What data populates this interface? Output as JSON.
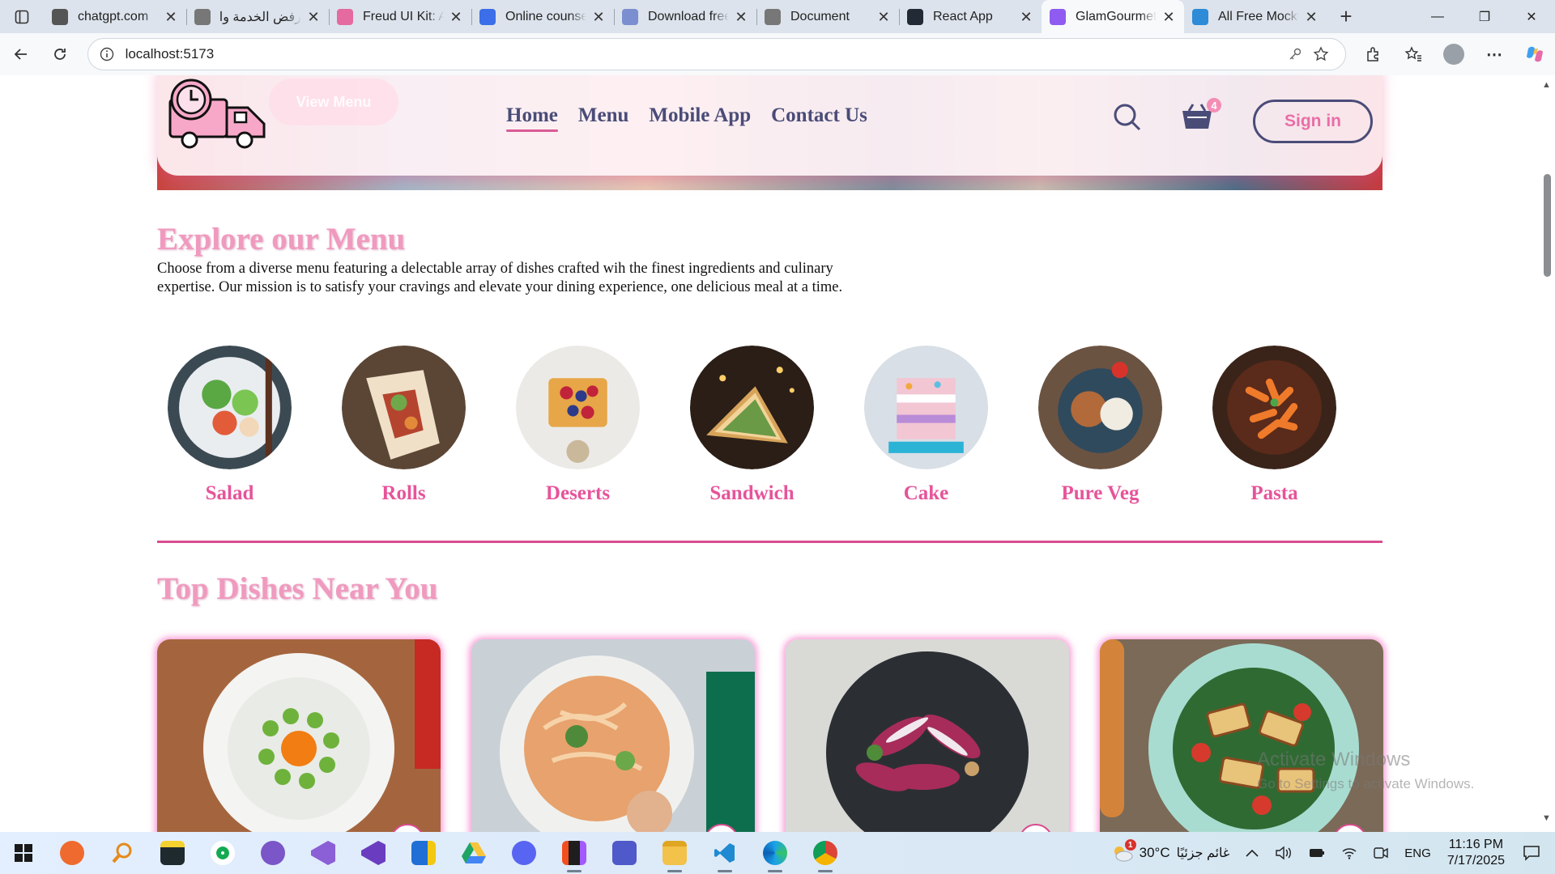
{
  "browser": {
    "tabs": [
      {
        "title": "chatgpt.com",
        "favicon": "chatgpt-icon",
        "color": "#555555"
      },
      {
        "title": "رفض الخدمة وال",
        "favicon": "globe-icon",
        "color": "#777777"
      },
      {
        "title": "Freud UI Kit: AI",
        "favicon": "figma-like-icon",
        "color": "#e46aa0"
      },
      {
        "title": "Online counsell",
        "favicon": "behance-icon",
        "color": "#3b6ee8"
      },
      {
        "title": "Download free",
        "favicon": "s-icon",
        "color": "#7b8fd0"
      },
      {
        "title": "Document",
        "favicon": "globe-icon",
        "color": "#777777"
      },
      {
        "title": "React App",
        "favicon": "react-icon",
        "color": "#222a36"
      },
      {
        "title": "GlamGourmet",
        "favicon": "vite-icon",
        "color": "#8f5bf0",
        "active": true
      },
      {
        "title": "All Free Mocku",
        "favicon": "mockup-icon",
        "color": "#2d8bd8"
      }
    ],
    "url": "localhost:5173"
  },
  "site": {
    "view_menu_label": "View Menu",
    "nav": [
      "Home",
      "Menu",
      "Mobile App",
      "Contact Us"
    ],
    "active_nav": "Home",
    "cart_count": "4",
    "signin_label": "Sign in",
    "explore_title": "Explore our Menu",
    "explore_desc": "Choose from a diverse menu featuring a delectable array of dishes crafted wih the finest ingredients and culinary expertise. Our mission is to satisfy your cravings and elevate your dining experience, one delicious meal at a time.",
    "menu_items": [
      {
        "label": "Salad",
        "image": "salad-image"
      },
      {
        "label": "Rolls",
        "image": "rolls-image"
      },
      {
        "label": "Deserts",
        "image": "deserts-image"
      },
      {
        "label": "Sandwich",
        "image": "sandwich-image"
      },
      {
        "label": "Cake",
        "image": "cake-image"
      },
      {
        "label": "Pure Veg",
        "image": "pure-veg-image"
      },
      {
        "label": "Pasta",
        "image": "pasta-image"
      }
    ],
    "top_dishes_title": "Top Dishes Near You",
    "dishes": [
      "asparagus-egg-dish",
      "noodle-salad-dish",
      "radicchio-salad-dish",
      "halloumi-salad-dish"
    ],
    "colors": {
      "accent_pink": "#e6549a",
      "title_pink": "#f09abf",
      "navy": "#4a4c78"
    }
  },
  "watermark": {
    "line1": "Activate Windows",
    "line2": "Go to Settings to activate Windows."
  },
  "taskbar": {
    "weather": "30°C",
    "weather_desc": "غائم جزئيًا",
    "weather_badge": "1",
    "language": "ENG",
    "time": "11:16 PM",
    "date": "7/17/2025"
  }
}
